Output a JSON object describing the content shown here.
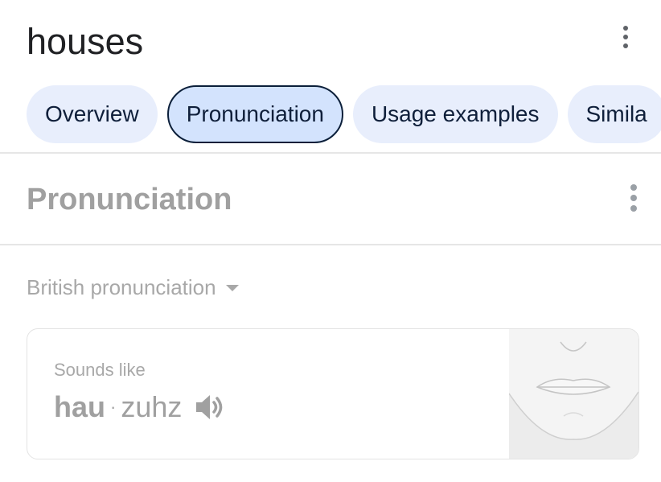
{
  "header": {
    "title": "houses"
  },
  "tabs": [
    {
      "label": "Overview",
      "active": false
    },
    {
      "label": "Pronunciation",
      "active": true
    },
    {
      "label": "Usage examples",
      "active": false
    },
    {
      "label": "Simila",
      "active": false
    }
  ],
  "section": {
    "title": "Pronunciation"
  },
  "dropdown": {
    "selected": "British pronunciation"
  },
  "card": {
    "sounds_like_label": "Sounds like",
    "syllable_stressed": "hau",
    "separator": "·",
    "syllable_unstressed": "zuhz"
  },
  "colors": {
    "accent": "#d3e3fd",
    "chip_bg": "#e8eefc",
    "active_border": "#0b1f3a"
  },
  "icons": [
    "more-vert-icon",
    "speaker-icon",
    "caret-down-icon",
    "mouth-illustration"
  ]
}
